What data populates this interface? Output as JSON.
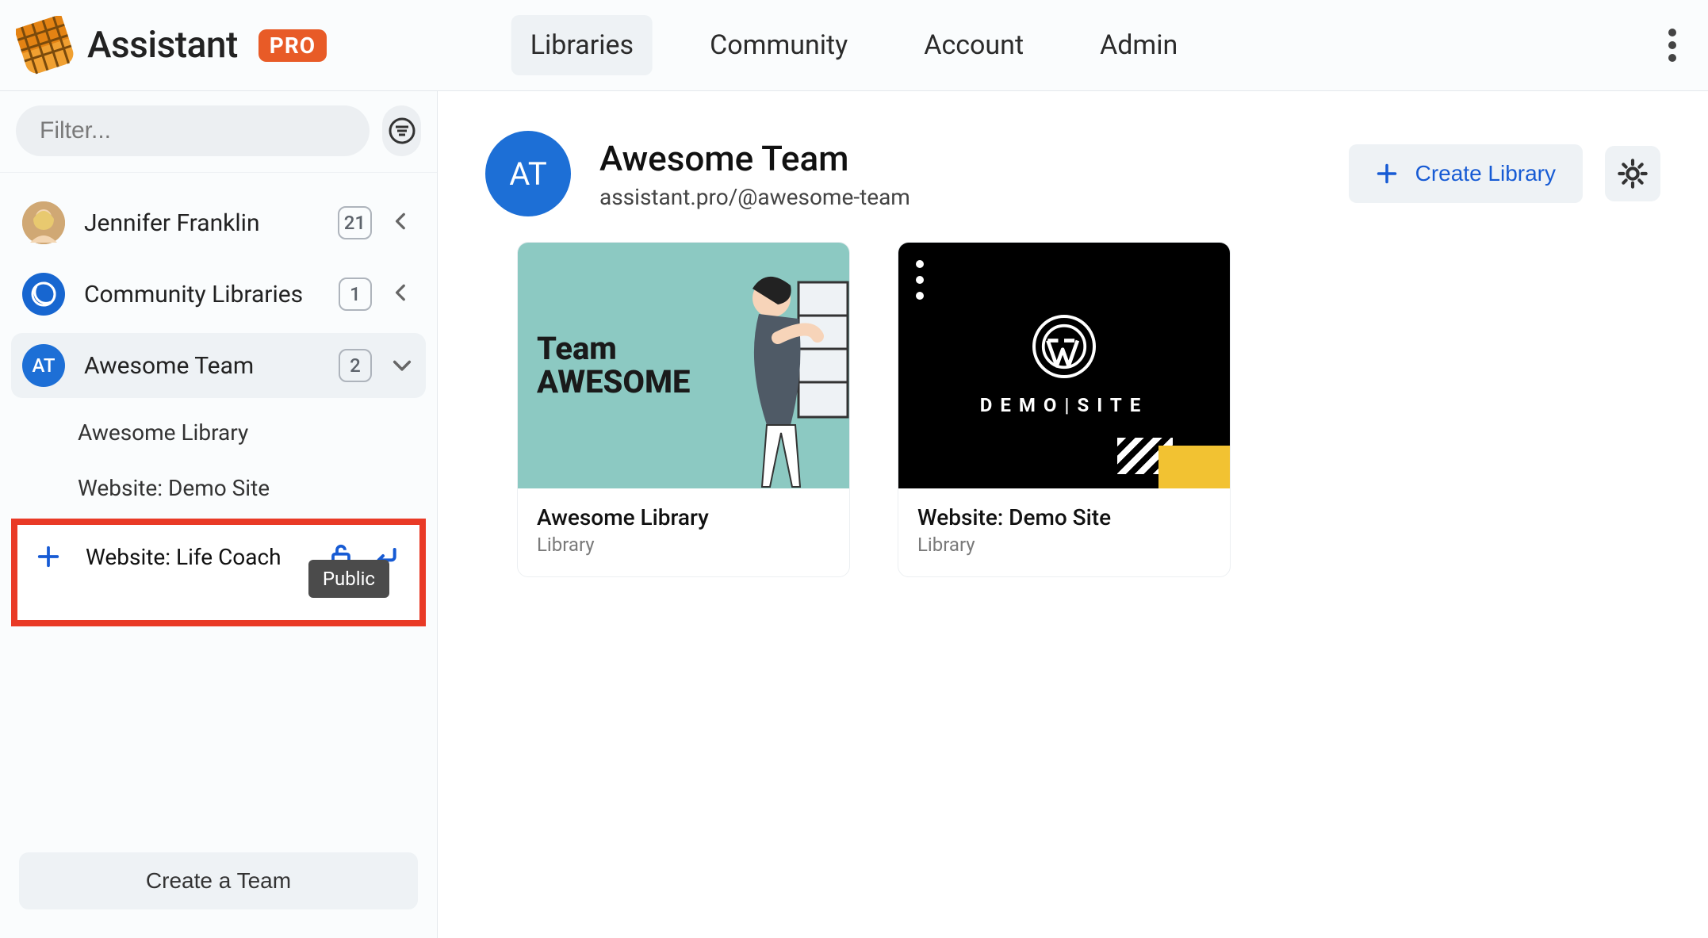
{
  "logo_text": "Assistant",
  "badge_pro": "PRO",
  "nav": {
    "libraries": "Libraries",
    "community": "Community",
    "account": "Account",
    "admin": "Admin"
  },
  "sidebar": {
    "filter_placeholder": "Filter...",
    "groups": [
      {
        "label": "Jennifer Franklin",
        "count": "21",
        "expanded": false,
        "avatar_text": "",
        "avatar_color": "#c8a16b"
      },
      {
        "label": "Community Libraries",
        "count": "1",
        "expanded": false,
        "avatar_text": "",
        "avatar_color": "#1766d0"
      },
      {
        "label": "Awesome Team",
        "count": "2",
        "expanded": true,
        "avatar_text": "AT",
        "avatar_color": "#1d6fd6"
      }
    ],
    "sublist": [
      {
        "label": "Awesome Library"
      },
      {
        "label": "Website: Demo Site"
      }
    ],
    "new_library": {
      "name": "Website: Life Coach",
      "tooltip": "Public"
    },
    "create_team_label": "Create a Team"
  },
  "team": {
    "avatar_text": "AT",
    "title": "Awesome Team",
    "url": "assistant.pro/@awesome-team",
    "create_library_label": "Create Library"
  },
  "cards": [
    {
      "title": "Awesome Library",
      "kind": "Library",
      "thumb_line1": "Team",
      "thumb_line2": "AWESOME"
    },
    {
      "title": "Website: Demo Site",
      "kind": "Library",
      "thumb_label": "DEMO|SITE"
    }
  ]
}
